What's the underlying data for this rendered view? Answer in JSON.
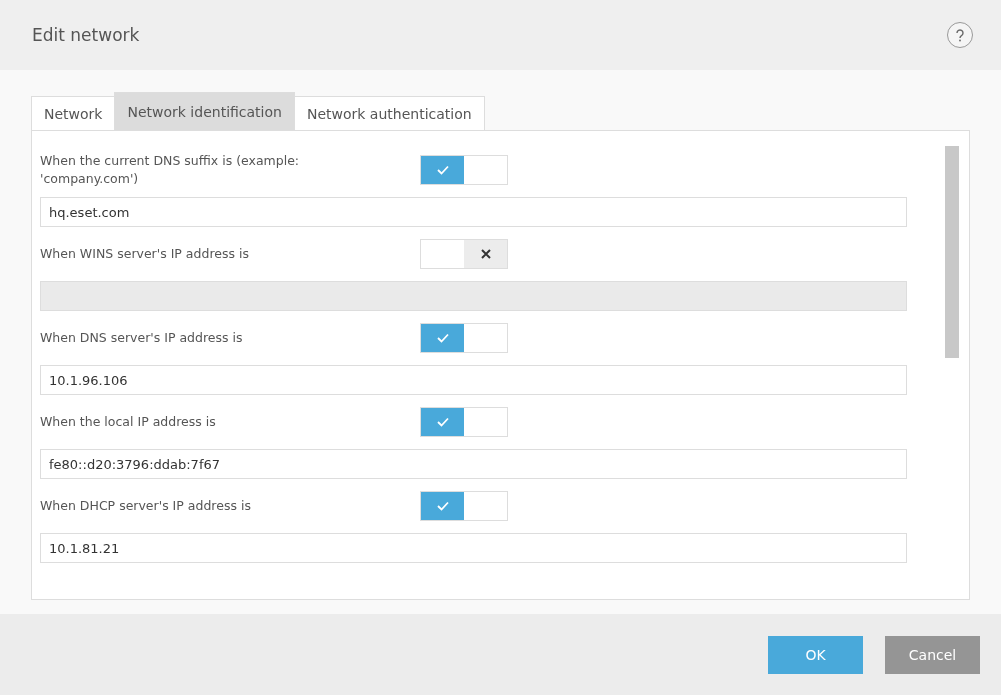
{
  "window": {
    "title": "Edit network"
  },
  "tabs": [
    {
      "label": "Network",
      "selected": false
    },
    {
      "label": "Network identification",
      "selected": true
    },
    {
      "label": "Network authentication",
      "selected": false
    }
  ],
  "conditions": [
    {
      "label": "When the current DNS suffix is (example: 'company.com')",
      "on": true,
      "value": "hq.eset.com"
    },
    {
      "label": "When WINS server's IP address is",
      "on": false
    },
    {
      "label": "When DNS server's IP address is",
      "on": true,
      "value": "10.1.96.106"
    },
    {
      "label": "When the local IP address is",
      "on": true,
      "value": "fe80::d20:3796:ddab:7f67"
    },
    {
      "label": "When DHCP server's IP address is",
      "on": true,
      "value": "10.1.81.21"
    }
  ],
  "buttons": [
    {
      "label": "OK",
      "kind": "primary"
    },
    {
      "label": "Cancel",
      "kind": "secondary"
    }
  ]
}
